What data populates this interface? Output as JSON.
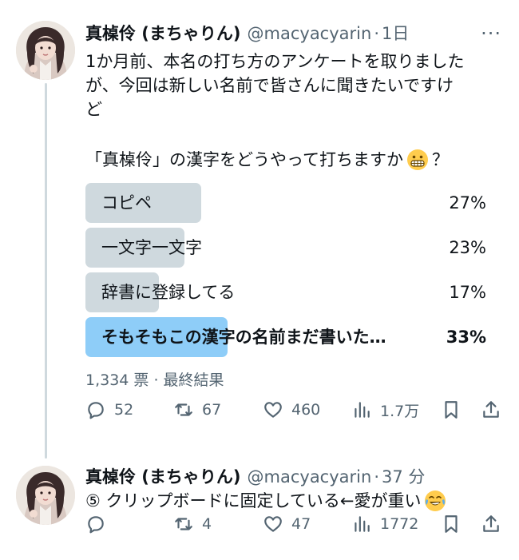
{
  "tweet1": {
    "author_name": "真槕伶 (まちゃりん)",
    "handle": "@macyacyarin",
    "separator": "·",
    "time": "1日",
    "more": "···",
    "text_lines": [
      "1か月前、本名の打ち方のアンケートを取りました",
      "が、今回は新しい名前で皆さんに聞きたいですけ",
      "ど"
    ],
    "question_prefix": "「真槕伶」の漢字をどうやって打ちますか",
    "question_suffix": "？",
    "question_emoji": "grimacing-face-emoji",
    "poll": {
      "options": [
        {
          "label": "コピペ",
          "percent": "27%",
          "value": 27,
          "winner": false
        },
        {
          "label": "一文字一文字",
          "percent": "23%",
          "value": 23,
          "winner": false
        },
        {
          "label": "辞書に登録してる",
          "percent": "17%",
          "value": 17,
          "winner": false
        },
        {
          "label": "そもそもこの漢字の名前まだ書いた…",
          "percent": "33%",
          "value": 33,
          "winner": true
        }
      ],
      "meta": "1,334 票 · 最終結果"
    },
    "actions": {
      "replies": "52",
      "retweets": "67",
      "likes": "460",
      "views": "1.7万"
    }
  },
  "tweet2": {
    "author_name": "真槕伶 (まちゃりん)",
    "handle": "@macyacyarin",
    "separator": "·",
    "time": "37 分",
    "text": "⑤ クリップボードに固定している←愛が重い",
    "text_emoji": "face-with-tears-of-joy-emoji",
    "actions": {
      "replies": "",
      "retweets": "4",
      "likes": "47",
      "views": "1772"
    }
  },
  "colors": {
    "text": "#0f1419",
    "secondary": "#536471",
    "poll_bar": "#cfd9de",
    "poll_bar_winner": "#8ecdf8",
    "thread_line": "#cfd9de"
  }
}
